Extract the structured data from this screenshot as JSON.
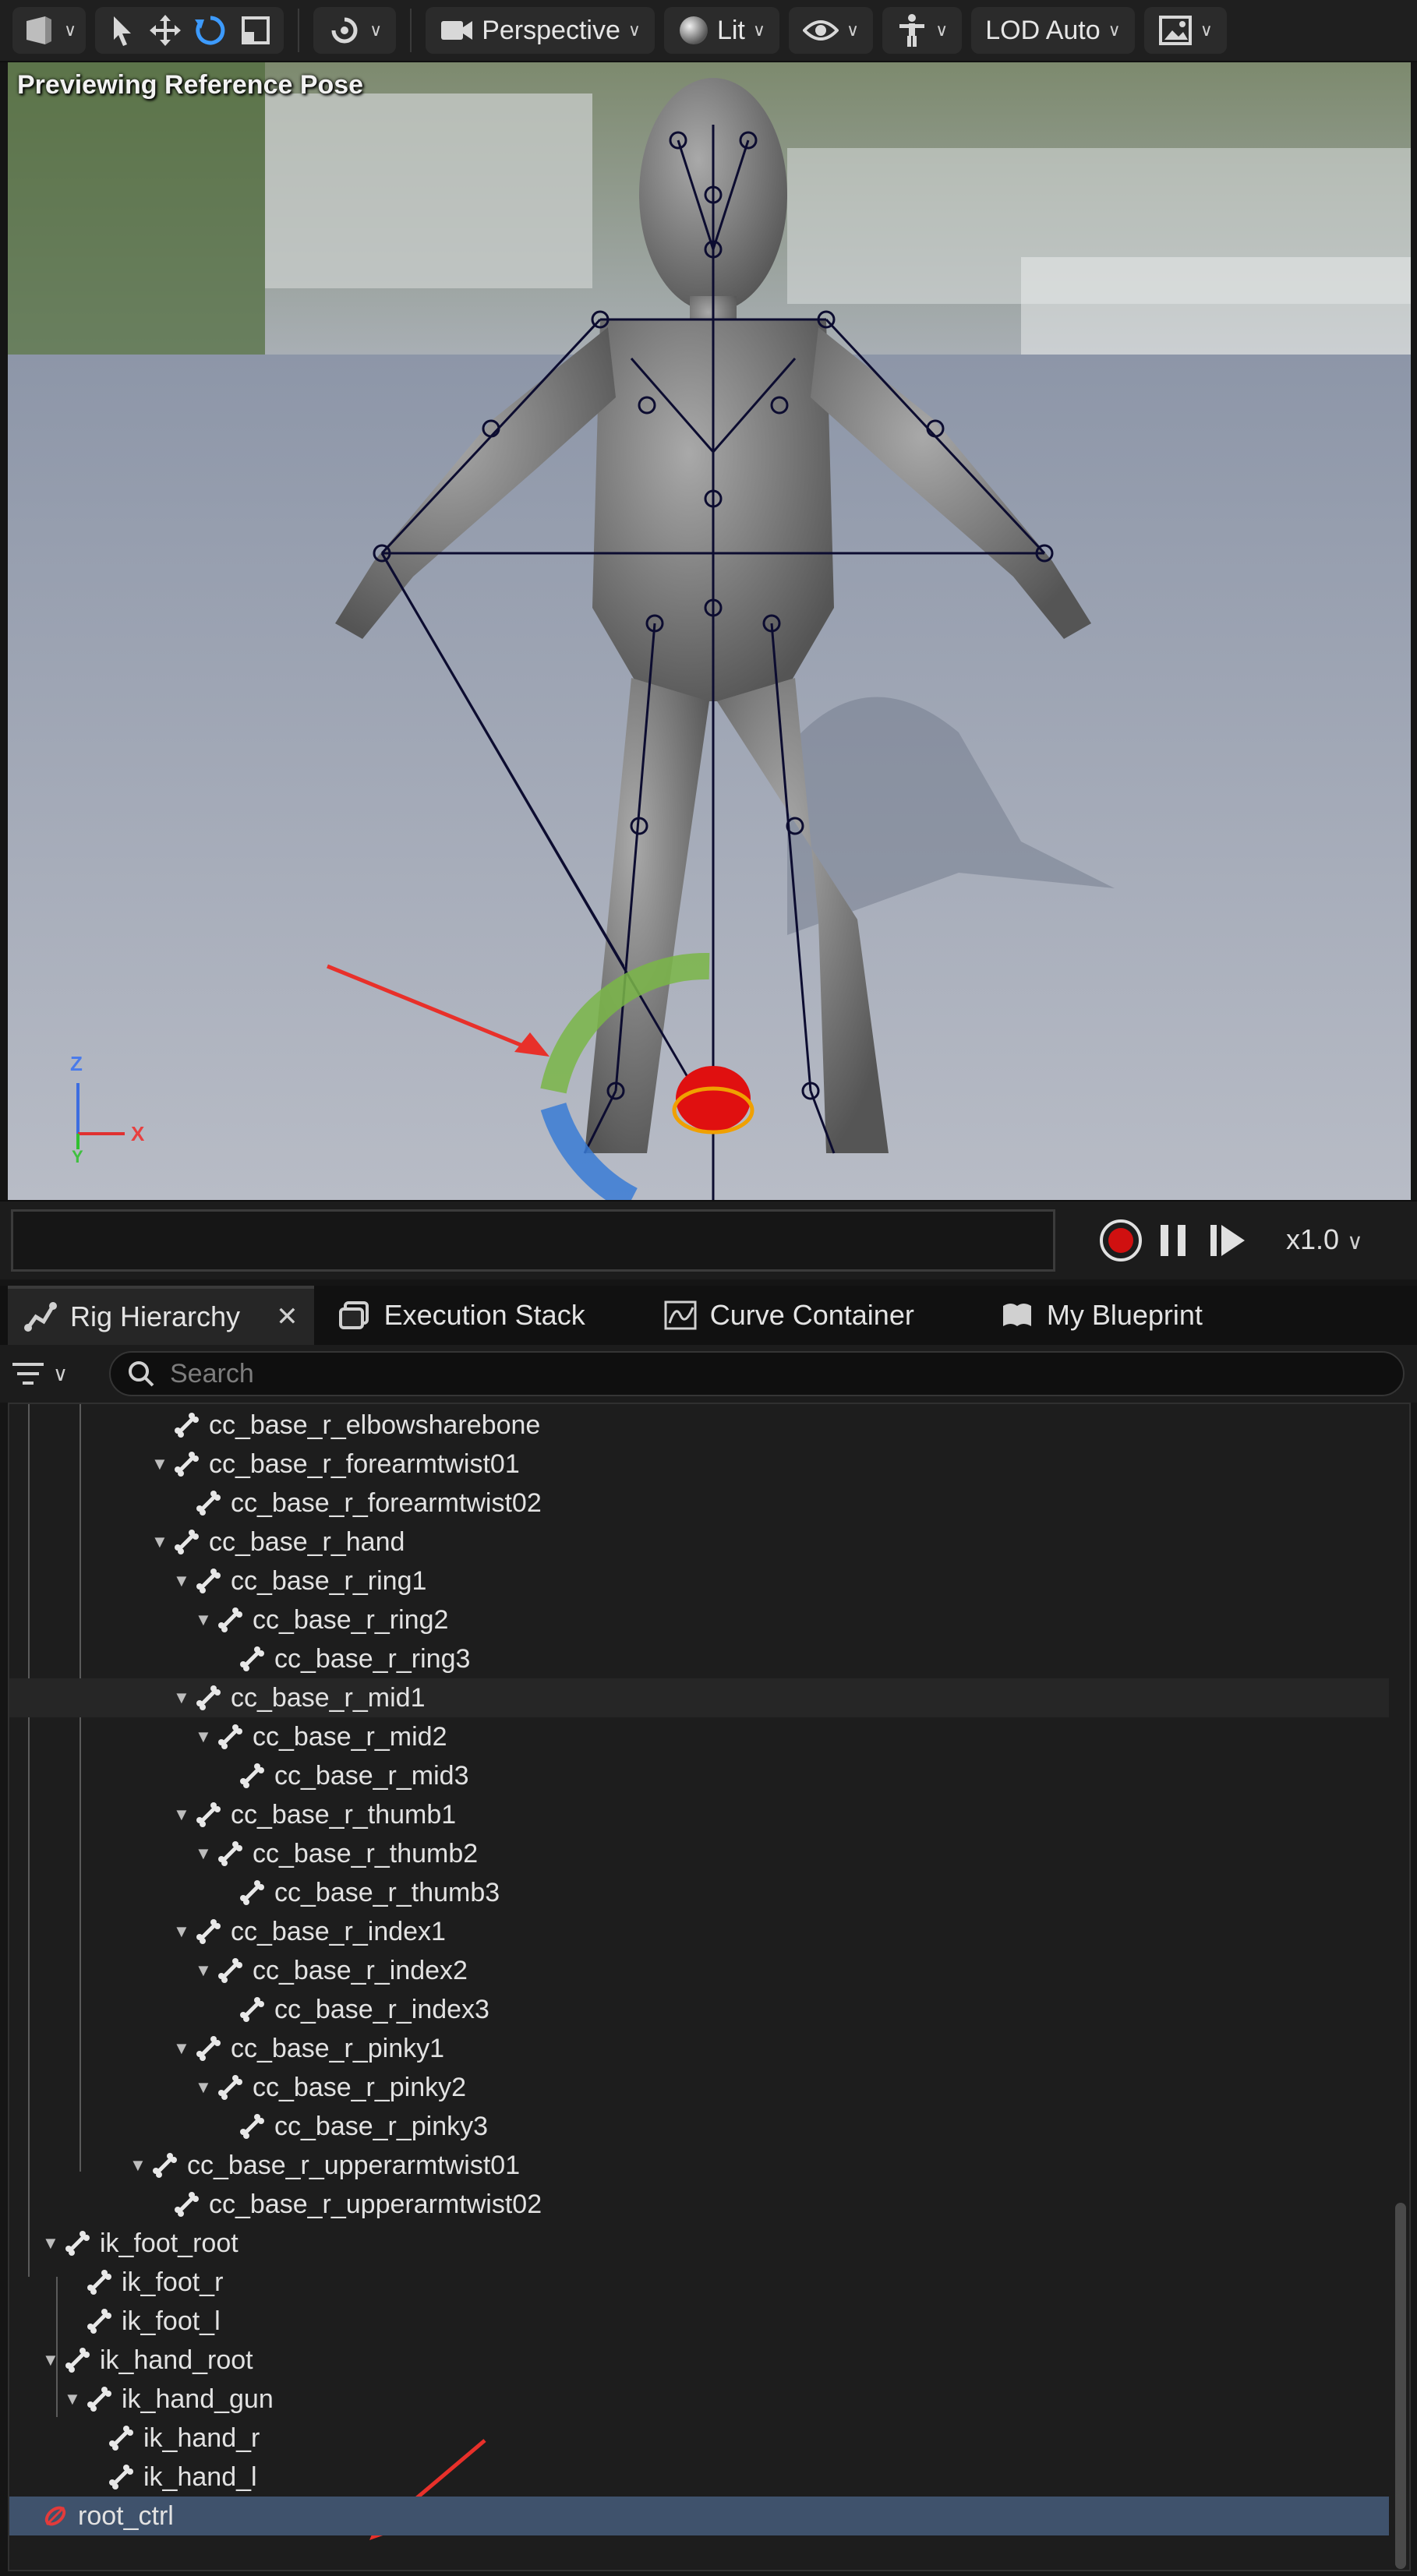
{
  "toolbar": {
    "perspective_label": "Perspective",
    "lit_label": "Lit",
    "lod_label": "LOD Auto"
  },
  "viewport": {
    "preview_label": "Previewing Reference Pose",
    "axis_z": "Z",
    "axis_x": "X",
    "axis_y": "Y"
  },
  "timeline": {
    "speed_label": "x1.0"
  },
  "tabs": [
    {
      "label": "Rig Hierarchy"
    },
    {
      "label": "Execution Stack"
    },
    {
      "label": "Curve Container"
    },
    {
      "label": "My Blueprint"
    }
  ],
  "search": {
    "placeholder": "Search"
  },
  "tree": {
    "rows": [
      {
        "label": "cc_base_r_elbowsharebone",
        "expander": false,
        "depth": 6
      },
      {
        "label": "cc_base_r_forearmtwist01",
        "expander": true,
        "depth": 6
      },
      {
        "label": "cc_base_r_forearmtwist02",
        "expander": false,
        "depth": 7
      },
      {
        "label": "cc_base_r_hand",
        "expander": true,
        "depth": 6
      },
      {
        "label": "cc_base_r_ring1",
        "expander": true,
        "depth": 7
      },
      {
        "label": "cc_base_r_ring2",
        "expander": true,
        "depth": 8
      },
      {
        "label": "cc_base_r_ring3",
        "expander": false,
        "depth": 9
      },
      {
        "label": "cc_base_r_mid1",
        "expander": true,
        "depth": 7
      },
      {
        "label": "cc_base_r_mid2",
        "expander": true,
        "depth": 8
      },
      {
        "label": "cc_base_r_mid3",
        "expander": false,
        "depth": 9
      },
      {
        "label": "cc_base_r_thumb1",
        "expander": true,
        "depth": 7
      },
      {
        "label": "cc_base_r_thumb2",
        "expander": true,
        "depth": 8
      },
      {
        "label": "cc_base_r_thumb3",
        "expander": false,
        "depth": 9
      },
      {
        "label": "cc_base_r_index1",
        "expander": true,
        "depth": 7
      },
      {
        "label": "cc_base_r_index2",
        "expander": true,
        "depth": 8
      },
      {
        "label": "cc_base_r_index3",
        "expander": false,
        "depth": 9
      },
      {
        "label": "cc_base_r_pinky1",
        "expander": true,
        "depth": 7
      },
      {
        "label": "cc_base_r_pinky2",
        "expander": true,
        "depth": 8
      },
      {
        "label": "cc_base_r_pinky3",
        "expander": false,
        "depth": 9
      },
      {
        "label": "cc_base_r_upperarmtwist01",
        "expander": true,
        "depth": 5
      },
      {
        "label": "cc_base_r_upperarmtwist02",
        "expander": false,
        "depth": 6
      },
      {
        "label": "ik_foot_root",
        "expander": true,
        "depth": 1
      },
      {
        "label": "ik_foot_r",
        "expander": false,
        "depth": 2
      },
      {
        "label": "ik_foot_l",
        "expander": false,
        "depth": 2
      },
      {
        "label": "ik_hand_root",
        "expander": true,
        "depth": 1
      },
      {
        "label": "ik_hand_gun",
        "expander": true,
        "depth": 2
      },
      {
        "label": "ik_hand_r",
        "expander": false,
        "depth": 3
      },
      {
        "label": "ik_hand_l",
        "expander": false,
        "depth": 3
      },
      {
        "label": "root_ctrl",
        "expander": false,
        "depth": 0,
        "control": true
      }
    ]
  },
  "colors": {
    "selected_row": "#3f526c",
    "annotation_arrow": "#e8302a",
    "gizmo_green": "#7ab648",
    "gizmo_blue": "#3a7bd5",
    "gizmo_red": "#e01010"
  }
}
